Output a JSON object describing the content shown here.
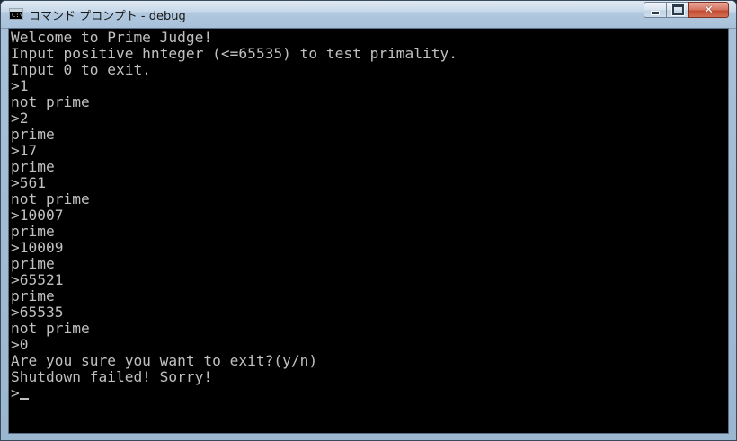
{
  "window": {
    "title": "コマンド プロンプト - debug",
    "icon": "console-icon",
    "icon_text": "C:\\",
    "controls": {
      "minimize": "minimize-icon",
      "maximize": "maximize-icon",
      "close": "close-icon",
      "close_glyph": "✕"
    }
  },
  "console": {
    "lines": [
      "Welcome to Prime Judge!",
      "Input positive hnteger (<=65535) to test primality.",
      "Input 0 to exit.",
      ">1",
      "not prime",
      ">2",
      "prime",
      ">17",
      "prime",
      ">561",
      "not prime",
      ">10007",
      "prime",
      ">10009",
      "prime",
      ">65521",
      "prime",
      ">65535",
      "not prime",
      ">0",
      "Are you sure you want to exit?(y/n)",
      "Shutdown failed! Sorry!",
      ">"
    ],
    "text_color": "#c0c0c0",
    "background": "#000000"
  }
}
